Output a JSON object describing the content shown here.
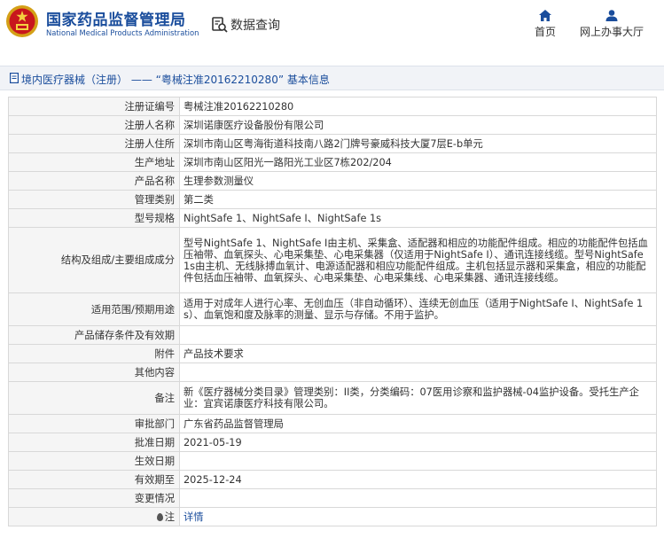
{
  "header": {
    "site_title": "国家药品监督管理局",
    "site_subtitle": "National Medical Products Administration",
    "data_query": "数据查询",
    "nav_home": "首页",
    "nav_online": "网上办事大厅",
    "brand_color": "#1a4d9c",
    "emblem_icon": "national-emblem-icon"
  },
  "page_title": "境内医疗器械（注册） —— “粤械注准20162210280” 基本信息",
  "rows": [
    {
      "label": "注册证编号",
      "value": "粤械注准20162210280"
    },
    {
      "label": "注册人名称",
      "value": "深圳诺康医疗设备股份有限公司"
    },
    {
      "label": "注册人住所",
      "value": "深圳市南山区粤海街道科技南八路2门牌号豪威科技大厦7层E-b单元"
    },
    {
      "label": "生产地址",
      "value": "深圳市南山区阳光一路阳光工业区7栋202/204"
    },
    {
      "label": "产品名称",
      "value": "生理参数测量仪"
    },
    {
      "label": "管理类别",
      "value": "第二类"
    },
    {
      "label": "型号规格",
      "value": "NightSafe 1、NightSafe I、NightSafe 1s"
    },
    {
      "label": "结构及组成/主要组成成分",
      "value": "型号NightSafe 1、NightSafe I由主机、采集盒、适配器和相应的功能配件组成。相应的功能配件包括血压袖带、血氧探头、心电采集垫、心电采集器（仅适用于NightSafe I）、通讯连接线缆。型号NightSafe 1s由主机、无线脉搏血氧计、电源适配器和相应功能配件组成。主机包括显示器和采集盒，相应的功能配件包括血压袖带、血氧探头、心电采集垫、心电采集线、心电采集器、通讯连接线缆。"
    },
    {
      "label": "适用范围/预期用途",
      "value": "适用于对成年人进行心率、无创血压（非自动循环）、连续无创血压（适用于NightSafe I、NightSafe 1s）、血氧饱和度及脉率的测量、显示与存储。不用于监护。"
    },
    {
      "label": "产品储存条件及有效期",
      "value": ""
    },
    {
      "label": "附件",
      "value": "产品技术要求"
    },
    {
      "label": "其他内容",
      "value": ""
    },
    {
      "label": "备注",
      "value": "新《医疗器械分类目录》管理类别：II类，分类编码：07医用诊察和监护器械-04监护设备。受托生产企业：宜宾诺康医疗科技有限公司。"
    },
    {
      "label": "审批部门",
      "value": "广东省药品监督管理局"
    },
    {
      "label": "批准日期",
      "value": "2021-05-19"
    },
    {
      "label": "生效日期",
      "value": ""
    },
    {
      "label": "有效期至",
      "value": "2025-12-24"
    },
    {
      "label": "变更情况",
      "value": ""
    }
  ],
  "note_row": {
    "label": "注",
    "link": "详情"
  }
}
